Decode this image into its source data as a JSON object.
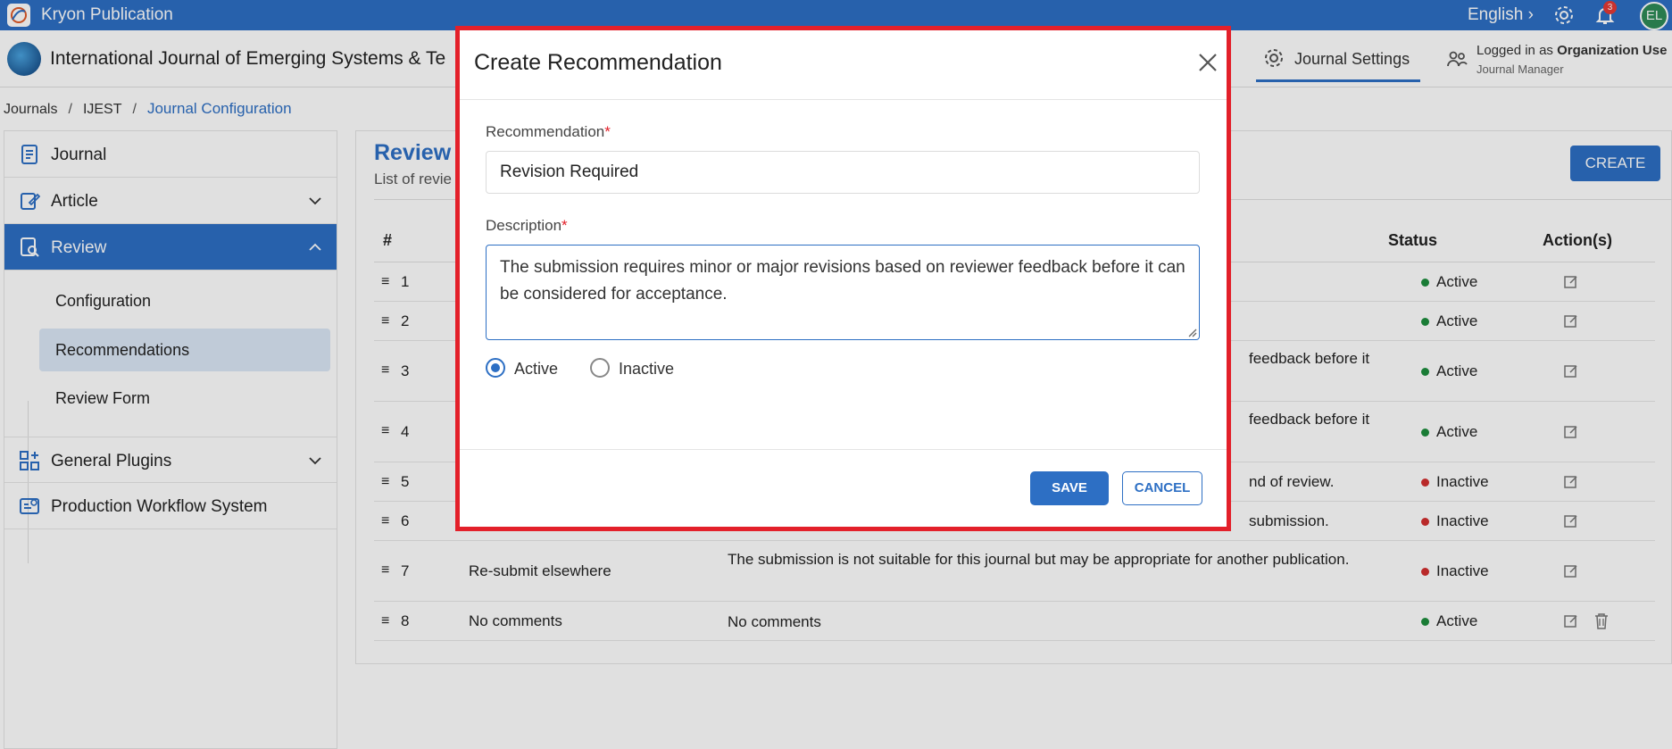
{
  "app": {
    "name": "Kryon Publication",
    "language": "English",
    "notification_count": "3",
    "avatar_initials": "EL"
  },
  "journal": {
    "name": "International Journal of Emerging Systems & Te"
  },
  "header": {
    "settings_tab": "Journal Settings",
    "logged_prefix": "Logged in as ",
    "logged_user": "Organization Use",
    "role": "Journal Manager"
  },
  "breadcrumb": {
    "items": [
      "Journals",
      "IJEST",
      "Journal Configuration"
    ]
  },
  "sidebar": {
    "journal": "Journal",
    "article": "Article",
    "review": "Review",
    "review_children": [
      "Configuration",
      "Recommendations",
      "Review Form"
    ],
    "general_plugins": "General Plugins",
    "production": "Production Workflow System"
  },
  "main": {
    "title": "Review",
    "subtitle": "List of revie",
    "create_label": "CREATE",
    "columns": {
      "num": "#",
      "status": "Status",
      "actions": "Action(s)"
    },
    "rows": [
      {
        "num": "1",
        "name": "",
        "desc": "",
        "status": "Active"
      },
      {
        "num": "2",
        "name": "",
        "desc": "",
        "status": "Active"
      },
      {
        "num": "3",
        "name": "",
        "desc": "feedback before it",
        "status": "Active"
      },
      {
        "num": "4",
        "name": "",
        "desc": "feedback before it",
        "status": "Active"
      },
      {
        "num": "5",
        "name": "",
        "desc": "nd of review.",
        "status": "Inactive"
      },
      {
        "num": "6",
        "name": "",
        "desc": "submission.",
        "status": "Inactive"
      },
      {
        "num": "7",
        "name": "Re-submit elsewhere",
        "desc": "The submission is not suitable for this journal but may be appropriate for another publication.",
        "status": "Inactive"
      },
      {
        "num": "8",
        "name": "No comments",
        "desc": "No comments",
        "status": "Active"
      }
    ]
  },
  "modal": {
    "title": "Create Recommendation",
    "recommendation_label": "Recommendation",
    "recommendation_value": "Revision Required",
    "description_label": "Description",
    "description_value": "The submission requires minor or major revisions based on reviewer feedback before it can be considered for acceptance.",
    "required_mark": "*",
    "radio_active": "Active",
    "radio_inactive": "Inactive",
    "save_label": "SAVE",
    "cancel_label": "CANCEL"
  },
  "colors": {
    "primary": "#2d6fc4",
    "active_dot": "#1e8e3e",
    "inactive_dot": "#d32f2f",
    "modal_border": "#e3202a"
  }
}
